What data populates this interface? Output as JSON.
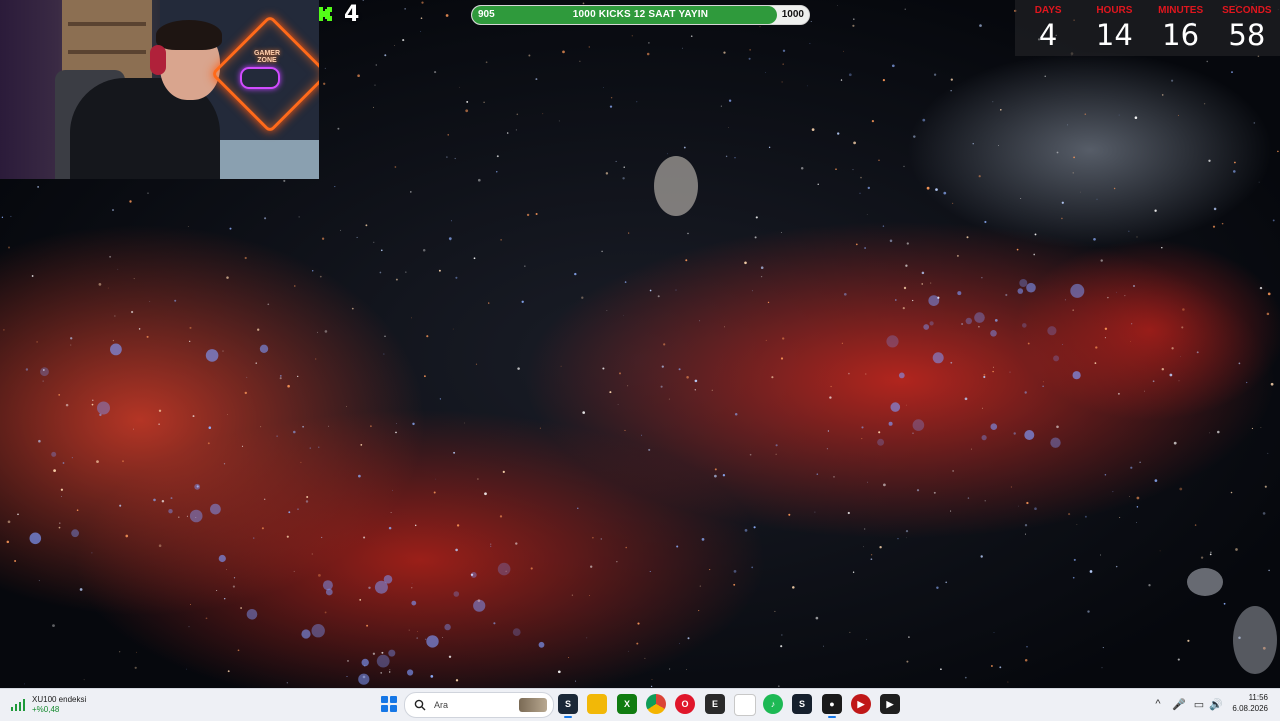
{
  "kick_counter": {
    "value": "4",
    "logo_color": "#53fc18"
  },
  "goal_bar": {
    "start_value": "905",
    "label": "1000 KICKS 12 SAAT YAYIN",
    "end_value": "1000",
    "progress_fraction": 0.905,
    "fill_color": "#2f9a3c"
  },
  "countdown": [
    {
      "label": "DAYS",
      "value": "4"
    },
    {
      "label": "HOURS",
      "value": "14"
    },
    {
      "label": "MINUTES",
      "value": "16"
    },
    {
      "label": "SECONDS",
      "value": "58"
    }
  ],
  "webcam": {
    "logo_text_1": "GAMER",
    "logo_text_2": "ZONE"
  },
  "taskbar": {
    "widget": {
      "title": "XU100 endeksi",
      "change": "+%0,48",
      "icon": "stock-chart-icon"
    },
    "search": {
      "placeholder": "Ara",
      "icon": "search-icon"
    },
    "apps": [
      {
        "name": "steam-icon",
        "color": "#1b2838",
        "glyph": "S"
      },
      {
        "name": "file-explorer-icon",
        "color": "#f2b807",
        "glyph": ""
      },
      {
        "name": "xbox-icon",
        "color": "#107c10",
        "glyph": "X"
      },
      {
        "name": "chrome-icon",
        "color": "#db4437",
        "glyph": ""
      },
      {
        "name": "opera-icon",
        "color": "#e0162b",
        "glyph": "O"
      },
      {
        "name": "epic-games-icon",
        "color": "#2a2a2a",
        "glyph": "E"
      },
      {
        "name": "notepad-icon",
        "color": "#ffffff",
        "glyph": ""
      },
      {
        "name": "spotify-icon",
        "color": "#1db954",
        "glyph": "♪"
      },
      {
        "name": "steam-client-icon",
        "color": "#16202d",
        "glyph": "S"
      },
      {
        "name": "obs-icon",
        "color": "#1a1a1a",
        "glyph": "●"
      },
      {
        "name": "media-player-icon",
        "color": "#c01818",
        "glyph": "▶"
      },
      {
        "name": "nvidia-icon",
        "color": "#1e1e1e",
        "glyph": "▶"
      }
    ],
    "tray": {
      "chevron": "^",
      "mic": "🎤",
      "network": "▭",
      "volume": "🔊"
    },
    "clock": {
      "time": "11:56",
      "date": "6.08.2026"
    }
  }
}
